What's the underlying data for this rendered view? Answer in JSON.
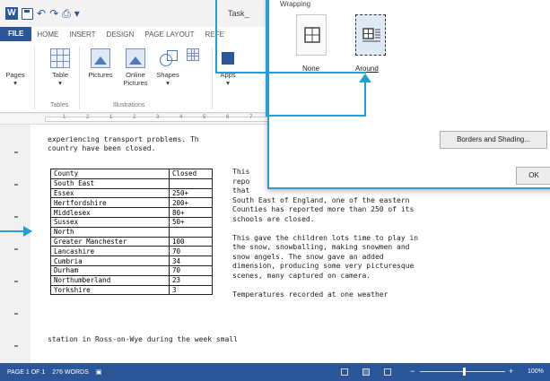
{
  "window": {
    "title": "Task_"
  },
  "tabs": [
    "FILE",
    "HOME",
    "INSERT",
    "DESIGN",
    "PAGE LAYOUT",
    "REFE"
  ],
  "ribbon": {
    "pages": "Pages",
    "table": "Table",
    "pictures": "Pictures",
    "online_pictures": "Online Pictures",
    "shapes": "Shapes",
    "apps": "Apps",
    "group_tables": "Tables",
    "group_illustrations": "Illustrations"
  },
  "ruler": [
    "1",
    "2",
    "1",
    "2",
    "3",
    "4",
    "5",
    "6",
    "7"
  ],
  "document": {
    "line1": "experiencing transport problems. Th",
    "line2": "country have been closed.",
    "right_col": [
      "This",
      "repo",
      "that",
      "South East of England, one of the eastern",
      "Counties has reported more than 250 of its",
      "schools are closed.",
      "",
      "This gave the children lots time to play in",
      "the snow, snowballing, making snowmen and",
      "snow angels. The snow gave an added",
      "dimension, producing some very picturesque",
      "scenes, many captured on camera.",
      "",
      "Temperatures recorded at one weather"
    ],
    "last_line": "station in Ross-on-Wye during the week small"
  },
  "county_table": {
    "headers": [
      "County",
      "Closed"
    ],
    "rows": [
      [
        "South East",
        ""
      ],
      [
        "Essex",
        "250+"
      ],
      [
        "Hertfordshire",
        "200+"
      ],
      [
        "Middlesex",
        "80+"
      ],
      [
        "Sussex",
        "50+"
      ],
      [
        "North",
        ""
      ],
      [
        "Greater Manchester",
        "100"
      ],
      [
        "Lancashire",
        "70"
      ],
      [
        "Cumbria",
        "34"
      ],
      [
        "Durham",
        "70"
      ],
      [
        "Northumberland",
        "23"
      ],
      [
        "Yorkshire",
        "3"
      ]
    ]
  },
  "dialog": {
    "header": "Wrapping",
    "option_none": "None",
    "option_around": "Around",
    "borders_button": "Borders and Shading...",
    "ok_button": "OK"
  },
  "statusbar": {
    "page": "PAGE 1 OF 1",
    "words": "276 WORDS",
    "zoom": "100%"
  },
  "colors": {
    "word_blue": "#2b579a",
    "callout_blue": "#1e9fd6"
  }
}
